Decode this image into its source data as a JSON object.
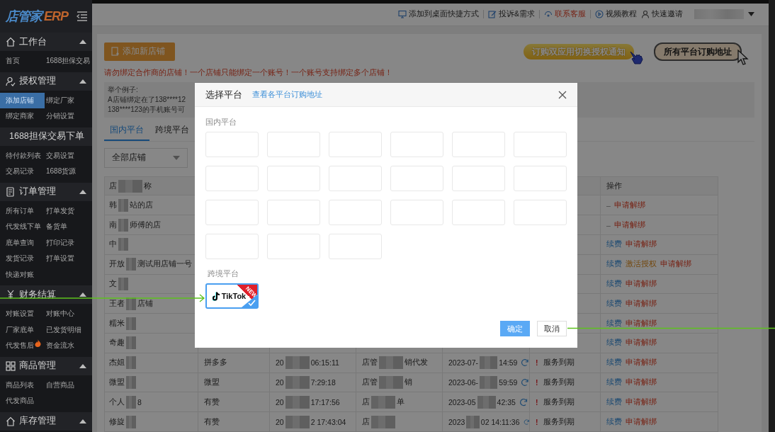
{
  "sidebar": {
    "logo": {
      "name": "店管家",
      "suffix": "ERP"
    },
    "sections": [
      {
        "title": "工作台",
        "expanded": true,
        "items": [
          {
            "label": "首页",
            "selected": false
          },
          {
            "label": "1688担保交易",
            "selected": false
          }
        ]
      },
      {
        "title": "授权管理",
        "expanded": true,
        "items": [
          {
            "label": "添加店铺",
            "selected": true
          },
          {
            "label": "绑定厂家",
            "selected": false
          },
          {
            "label": "绑定商家",
            "selected": false
          },
          {
            "label": "分销设置",
            "selected": false
          }
        ]
      },
      {
        "title": "1688担保交易下单",
        "expanded": true,
        "items": [
          {
            "label": "待付款列表",
            "selected": false
          },
          {
            "label": "交易设置",
            "selected": false
          },
          {
            "label": "交易记录",
            "selected": false
          },
          {
            "label": "1688货源",
            "selected": false
          }
        ]
      },
      {
        "title": "订单管理",
        "expanded": true,
        "items": [
          {
            "label": "所有订单",
            "selected": false
          },
          {
            "label": "打单发货",
            "selected": false
          },
          {
            "label": "代发线下单",
            "selected": false
          },
          {
            "label": "备货单",
            "selected": false
          },
          {
            "label": "底单查询",
            "selected": false
          },
          {
            "label": "打印记录",
            "selected": false
          },
          {
            "label": "发货记录",
            "selected": false
          },
          {
            "label": "打单设置",
            "selected": false
          },
          {
            "label": "快递对账",
            "selected": false
          }
        ]
      },
      {
        "title": "财务结算",
        "expanded": true,
        "items": [
          {
            "label": "对账设置",
            "selected": false
          },
          {
            "label": "对账中心",
            "selected": false
          },
          {
            "label": "厂家底单",
            "selected": false
          },
          {
            "label": "已发货明细",
            "selected": false
          },
          {
            "label": "代发售后",
            "selected": false,
            "hot": true
          },
          {
            "label": "资金流水",
            "selected": false
          }
        ]
      },
      {
        "title": "商品管理",
        "expanded": true,
        "items": [
          {
            "label": "商品列表",
            "selected": false
          },
          {
            "label": "自营商品",
            "selected": false
          },
          {
            "label": "代发商品",
            "selected": false
          }
        ]
      },
      {
        "title": "库存管理",
        "expanded": true
      }
    ]
  },
  "top_links": [
    {
      "label": "添加到桌面快捷方式",
      "kind": "normal"
    },
    {
      "label": "投诉&需求",
      "kind": "normal"
    },
    {
      "label": "联系客服",
      "kind": "highlight"
    },
    {
      "label": "视频教程",
      "kind": "normal"
    },
    {
      "label": "快速邀请",
      "kind": "normal"
    }
  ],
  "add_button": "添加新店铺",
  "banners": [
    {
      "label": "订购双应用切换授权通知",
      "kind": "notice"
    },
    {
      "label": "所有平台订购地址",
      "kind": "address"
    }
  ],
  "warning": "请勿绑定合作商的店铺！一个店铺只能绑定一个账号！一个账号支持绑定多个店铺！",
  "example": [
    "举个例子:",
    "A店铺绑定在了138****12",
    "138****123的手机账号可"
  ],
  "tabs": [
    {
      "label": "国内平台",
      "selected": true
    },
    {
      "label": "跨境平台",
      "selected": false
    }
  ],
  "filter": "全部店铺",
  "table": {
    "columns": [
      {
        "start": "店",
        "end": "称"
      },
      {},
      {},
      {},
      {},
      {},
      {
        "start": "操作"
      }
    ],
    "rows": [
      {
        "name": {
          "start": "韩",
          "end": "站的店"
        },
        "actions": [
          {
            "kind": "dash",
            "label": "–"
          },
          {
            "kind": "unbind",
            "label": "申请解绑"
          }
        ]
      },
      {
        "name": {
          "start": "南",
          "end": "师傅的店"
        },
        "actions": [
          {
            "kind": "dash",
            "label": "–"
          },
          {
            "kind": "unbind",
            "label": "申请解绑"
          }
        ]
      },
      {
        "name": {
          "start": "中"
        },
        "actions": [
          {
            "kind": "renew",
            "label": "续费"
          },
          {
            "kind": "unbind",
            "label": "申请解绑"
          }
        ]
      },
      {
        "name": {
          "start": "开放",
          "end": "测试用店铺一号"
        },
        "actions": [
          {
            "kind": "renew",
            "label": "续费"
          },
          {
            "kind": "activate",
            "label": "激活授权"
          },
          {
            "kind": "unbind",
            "label": "申请解绑"
          }
        ]
      },
      {
        "name": {
          "start": "文"
        },
        "actions": [
          {
            "kind": "renew",
            "label": "续费"
          },
          {
            "kind": "unbind",
            "label": "申请解绑"
          }
        ]
      },
      {
        "name": {
          "start": "王者",
          "end": "店铺"
        },
        "actions": [
          {
            "kind": "renew",
            "label": "续费"
          },
          {
            "kind": "unbind",
            "label": "申请解绑"
          }
        ]
      },
      {
        "name": {
          "start": "糯米"
        },
        "actions": [
          {
            "kind": "renew",
            "label": "续费"
          },
          {
            "kind": "unbind",
            "label": "申请解绑"
          }
        ]
      },
      {
        "name": {
          "start": "奇趣"
        },
        "actions": [
          {
            "kind": "renew",
            "label": "续费"
          },
          {
            "kind": "unbind",
            "label": "申请解绑"
          }
        ]
      },
      {
        "name": {
          "start": "杰姐"
        },
        "platform": "拼多多",
        "created": {
          "start": "20",
          "end": "06:15:11"
        },
        "type": {
          "start": "店管",
          "end": "销代发"
        },
        "expiry": {
          "start": "2023-07-",
          "end": "14:59"
        },
        "status": {
          "mark": "!",
          "text": "服务到期"
        },
        "actions": [
          {
            "kind": "renew",
            "label": "续费"
          },
          {
            "kind": "unbind",
            "label": "申请解绑"
          }
        ]
      },
      {
        "name": {
          "start": "微盟"
        },
        "platform": "微盟",
        "created": {
          "start": "20",
          "end": "7:29:18"
        },
        "type": {
          "start": "店管",
          "end": "销"
        },
        "expiry": {
          "start": "2023-06-",
          "end": "59:59"
        },
        "status": {
          "mark": "!",
          "text": "服务到期"
        },
        "actions": [
          {
            "kind": "renew",
            "label": "续费"
          },
          {
            "kind": "unbind",
            "label": "申请解绑"
          }
        ]
      },
      {
        "name": {
          "start": "个人",
          "end": "8"
        },
        "platform": "有赞",
        "created": {
          "start": "20",
          "end": "17:17:56"
        },
        "type": {
          "start": "店",
          "end": "单"
        },
        "expiry": {
          "start": "2023-05",
          "end": "42:35"
        },
        "status": {
          "mark": "!",
          "text": "服务到期"
        },
        "actions": [
          {
            "kind": "renew",
            "label": "续费"
          },
          {
            "kind": "unbind",
            "label": "申请解绑"
          }
        ]
      },
      {
        "name": {
          "start": "修旋"
        },
        "platform": "有赞",
        "created": {
          "start": "20",
          "end": "2 17:43:04"
        },
        "type": {
          "start": "店"
        },
        "expiry": {
          "start": "2023",
          "end": "02 14:11:36"
        },
        "status": {
          "mark": "!",
          "text": "服务到期"
        },
        "actions": [
          {
            "kind": "renew",
            "label": "续费"
          },
          {
            "kind": "unbind",
            "label": "申请解绑"
          }
        ]
      }
    ]
  },
  "dialog": {
    "title": "选择平台",
    "link": "查看各平台订购地址",
    "domestic_label": "国内平台",
    "domestic_platforms": [
      {
        "selected": false
      },
      {
        "selected": false
      },
      {
        "selected": false
      },
      {
        "selected": false
      },
      {
        "selected": false
      },
      {
        "selected": false
      },
      {
        "selected": false
      },
      {
        "selected": false
      },
      {
        "selected": false
      },
      {
        "selected": false
      },
      {
        "selected": false
      },
      {
        "selected": false
      },
      {
        "selected": false
      },
      {
        "selected": false
      },
      {
        "selected": false
      },
      {
        "selected": false
      },
      {
        "selected": false
      },
      {
        "selected": false
      },
      {
        "selected": false
      },
      {
        "selected": false
      },
      {
        "selected": false
      }
    ],
    "crossborder_label": "跨境平台",
    "crossborder_platforms": [
      {
        "name": "TikTok",
        "badge": "NEW",
        "selected": true
      }
    ],
    "buttons": [
      {
        "label": "确定",
        "kind": "primary"
      },
      {
        "label": "取消",
        "kind": "default"
      }
    ]
  }
}
